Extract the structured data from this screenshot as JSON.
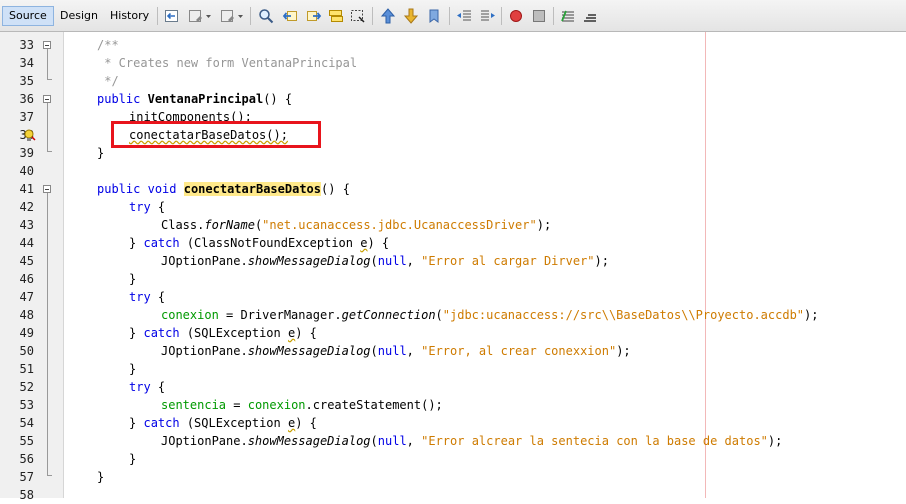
{
  "tabs": [
    "Source",
    "Design",
    "History"
  ],
  "toolbar_icons": [
    "back-history-icon",
    "last-edit-icon",
    "forward-icon",
    "find-selection-icon",
    "find-previous-icon",
    "find-next-icon",
    "toggle-highlight-icon",
    "toggle-rectangular-icon",
    "previous-bookmark-icon",
    "next-bookmark-icon",
    "toggle-bookmark-icon",
    "shift-left-icon",
    "shift-right-icon",
    "start-macro-icon",
    "stop-macro-icon",
    "comment-icon",
    "uncomment-icon"
  ],
  "line_numbers": [
    "33",
    "34",
    "35",
    "36",
    "37",
    "38",
    "39",
    "40",
    "41",
    "42",
    "43",
    "44",
    "45",
    "46",
    "47",
    "48",
    "49",
    "50",
    "51",
    "52",
    "53",
    "54",
    "55",
    "56",
    "57",
    "58"
  ],
  "code": {
    "l33": "/**",
    "l34": " * Creates new form VentanaPrincipal",
    "l35": " */",
    "l36_kw": "public",
    "l36_name": "VentanaPrincipal",
    "l36_rest": "() {",
    "l37": "initComponents();",
    "l38": "conectatarBaseDatos();",
    "l39": "}",
    "l41_kw1": "public",
    "l41_kw2": "void",
    "l41_name": "conectatarBaseDatos",
    "l41_rest": "() {",
    "try": "try",
    "catch": "catch",
    "open_brace": " {",
    "close_brace": "}",
    "l43_a": "Class.",
    "l43_b": "forName",
    "l43_c": "(",
    "l43_str": "\"net.ucanaccess.jdbc.UcanaccessDriver\"",
    "l43_d": ");",
    "l44_a": "(ClassNotFoundException ",
    "l44_e": "e",
    "l44_b": ") {",
    "jop": "JOptionPane.",
    "show": "showMessageDialog",
    "paren_open": "(",
    "null": "null",
    "comma": ", ",
    "end_call": ");",
    "l45_str": "\"Error al cargar Dirver\"",
    "l48_fld": "conexion",
    "l48_a": " = DriverManager.",
    "l48_b": "getConnection",
    "l48_str": "\"jdbc:ucanaccess://src\\\\BaseDatos\\\\Proyecto.accdb\"",
    "l49_a": "(SQLException ",
    "l49_e": "e",
    "l49_b": ") {",
    "l50_str": "\"Error, al crear conexxion\"",
    "l53_fld1": "sentencia",
    "l53_a": " = ",
    "l53_fld2": "conexion",
    "l53_b": ".createStatement();",
    "l55_str": "\"Error alcrear la sentecia con la base de datos\""
  },
  "colors": {
    "keyword": "#0000e6",
    "string": "#ce7b00",
    "field": "#009900",
    "comment": "#969696",
    "highlight": "#ffe98a",
    "annotation_box": "#e8141c"
  }
}
